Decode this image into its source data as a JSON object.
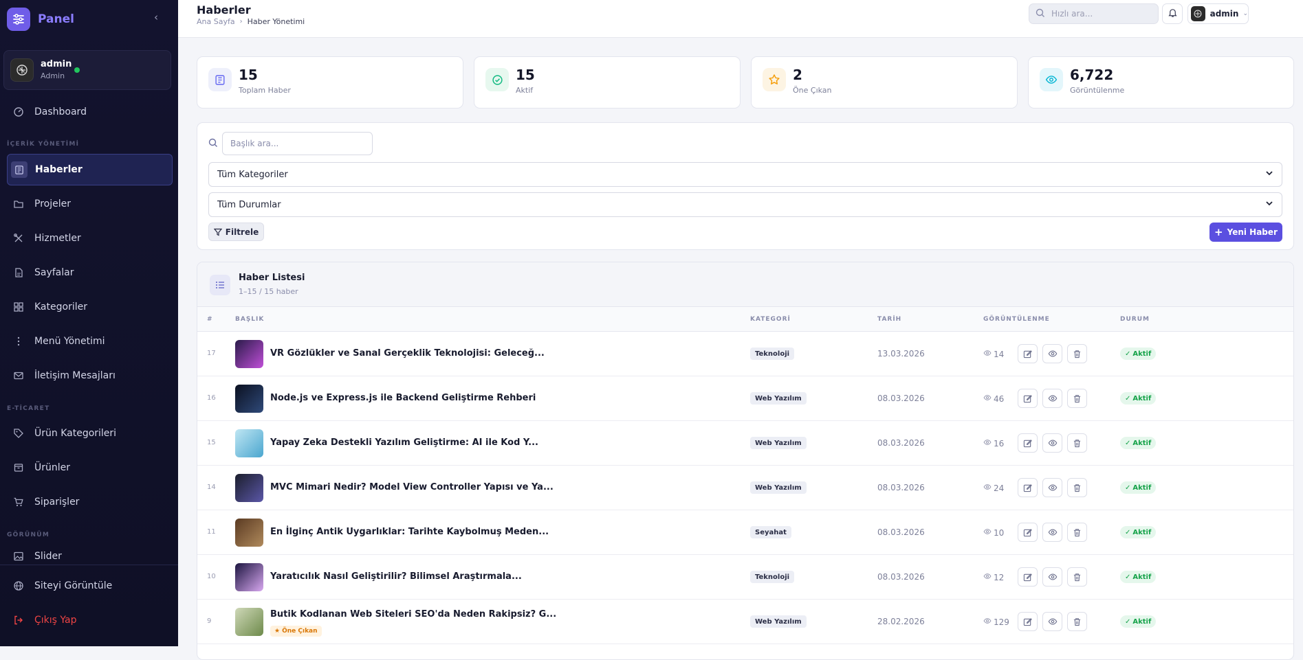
{
  "sidebar": {
    "brand": "Panel",
    "user": {
      "name": "admin",
      "role": "Admin"
    },
    "items": [
      {
        "label": "Dashboard",
        "icon": "dashboard-icon"
      },
      {
        "section": "İÇERİK YÖNETİMİ"
      },
      {
        "label": "Haberler",
        "icon": "news-icon",
        "active": true
      },
      {
        "label": "Projeler",
        "icon": "folder-icon"
      },
      {
        "label": "Hizmetler",
        "icon": "tools-icon"
      },
      {
        "label": "Sayfalar",
        "icon": "page-icon"
      },
      {
        "label": "Kategoriler",
        "icon": "grid-icon"
      },
      {
        "label": "Menü Yönetimi",
        "icon": "menu-dots-icon"
      },
      {
        "label": "İletişim Mesajları",
        "icon": "mail-icon"
      },
      {
        "section": "E-TİCARET"
      },
      {
        "label": "Ürün Kategorileri",
        "icon": "tag-icon"
      },
      {
        "label": "Ürünler",
        "icon": "box-icon"
      },
      {
        "label": "Siparişler",
        "icon": "cart-icon"
      },
      {
        "section": "GÖRÜNÜM"
      },
      {
        "label": "Slider",
        "icon": "image-icon"
      }
    ],
    "view_site": "Siteyi Görüntüle",
    "logout": "Çıkış Yap"
  },
  "header": {
    "title": "Haberler",
    "breadcrumb": [
      "Ana Sayfa",
      "Haber Yönetimi"
    ],
    "search_placeholder": "Hızlı ara...",
    "user": "admin"
  },
  "stats": [
    {
      "value": "15",
      "label": "Toplam Haber",
      "icon": "news-icon",
      "color": "#6366f1",
      "bg": "#eef0fb"
    },
    {
      "value": "15",
      "label": "Aktif",
      "icon": "check-circle-icon",
      "color": "#10b981",
      "bg": "#e7f8ef"
    },
    {
      "value": "2",
      "label": "Öne Çıkan",
      "icon": "star-icon",
      "color": "#f59e0b",
      "bg": "#fdf4e3"
    },
    {
      "value": "6,722",
      "label": "Görüntülenme",
      "icon": "eye-icon",
      "color": "#06b6d4",
      "bg": "#e3f6fb"
    }
  ],
  "filters": {
    "search_placeholder": "Başlık ara...",
    "category": "Tüm Kategoriler",
    "status": "Tüm Durumlar",
    "filter_button": "Filtrele",
    "new_button": "Yeni Haber"
  },
  "list": {
    "title": "Haber Listesi",
    "subtitle": "1–15 / 15 haber",
    "columns": [
      "#",
      "BAŞLIK",
      "KATEGORİ",
      "TARİH",
      "GÖRÜNTÜLENME",
      "DURUM"
    ],
    "rows": [
      {
        "id": "17",
        "title": "VR Gözlükler ve Sanal Gerçeklik Teknolojisi: Geleceğ...",
        "category": "Teknoloji",
        "date": "13.03.2026",
        "views": "14",
        "status": "Aktif",
        "featured": false,
        "thumb": [
          "#2a1b4a",
          "#c04fd8"
        ]
      },
      {
        "id": "16",
        "title": "Node.js ve Express.js ile Backend Geliştirme Rehberi",
        "category": "Web Yazılım",
        "date": "08.03.2026",
        "views": "46",
        "status": "Aktif",
        "featured": false,
        "thumb": [
          "#0b1020",
          "#2f4a7a"
        ]
      },
      {
        "id": "15",
        "title": "Yapay Zeka Destekli Yazılım Geliştirme: AI ile Kod Y...",
        "category": "Web Yazılım",
        "date": "08.03.2026",
        "views": "16",
        "status": "Aktif",
        "featured": false,
        "thumb": [
          "#bfe6f3",
          "#4aa6cf"
        ]
      },
      {
        "id": "14",
        "title": "MVC Mimari Nedir? Model View Controller Yapısı ve Ya...",
        "category": "Web Yazılım",
        "date": "08.03.2026",
        "views": "24",
        "status": "Aktif",
        "featured": false,
        "thumb": [
          "#1b1e2c",
          "#5b57a8"
        ]
      },
      {
        "id": "11",
        "title": "En İlginç Antik Uygarlıklar: Tarihte Kaybolmuş Meden...",
        "category": "Seyahat",
        "date": "08.03.2026",
        "views": "10",
        "status": "Aktif",
        "featured": false,
        "thumb": [
          "#5a3a22",
          "#b08a5c"
        ]
      },
      {
        "id": "10",
        "title": "Yaratıcılık Nasıl Geliştirilir? Bilimsel Araştırmala...",
        "category": "Teknoloji",
        "date": "08.03.2026",
        "views": "12",
        "status": "Aktif",
        "featured": false,
        "thumb": [
          "#1c1540",
          "#d8a8f0"
        ]
      },
      {
        "id": "9",
        "title": "Butik Kodlanan Web Siteleri SEO'da Neden Rakipsiz? G...",
        "category": "Web Yazılım",
        "date": "28.02.2026",
        "views": "129",
        "status": "Aktif",
        "featured": true,
        "featured_label": "Öne Çıkan",
        "thumb": [
          "#cfd8b8",
          "#6d8a4a"
        ]
      }
    ]
  }
}
